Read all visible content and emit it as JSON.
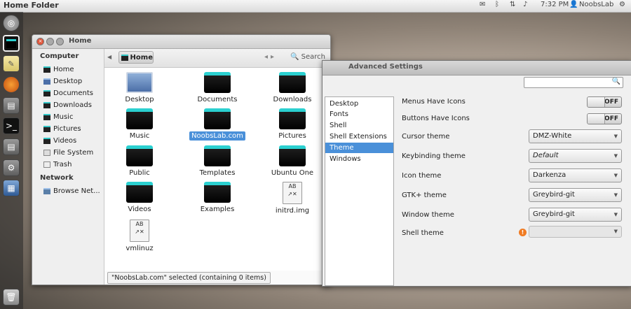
{
  "panel": {
    "title": "Home Folder",
    "clock": "7:32 PM",
    "user": "NoobsLab"
  },
  "launcher": {
    "items": [
      "dash-home",
      "home-folder",
      "text-editor",
      "firefox",
      "system-monitor",
      "terminal",
      "system-monitor-2",
      "system-settings",
      "workspace-switcher",
      "trash"
    ]
  },
  "file_manager": {
    "title": "Home",
    "sidebar": {
      "computer_heading": "Computer",
      "computer_items": [
        "Home",
        "Desktop",
        "Documents",
        "Downloads",
        "Music",
        "Pictures",
        "Videos",
        "File System",
        "Trash"
      ],
      "network_heading": "Network",
      "network_items": [
        "Browse Net..."
      ]
    },
    "breadcrumb": "Home",
    "search_label": "Search",
    "items": [
      {
        "label": "Desktop",
        "kind": "desktop"
      },
      {
        "label": "Documents",
        "kind": "folder"
      },
      {
        "label": "Downloads",
        "kind": "folder"
      },
      {
        "label": "Music",
        "kind": "folder"
      },
      {
        "label": "NoobsLab.com",
        "kind": "folder",
        "selected": true
      },
      {
        "label": "Pictures",
        "kind": "folder"
      },
      {
        "label": "Public",
        "kind": "folder"
      },
      {
        "label": "Templates",
        "kind": "folder"
      },
      {
        "label": "Ubuntu One",
        "kind": "folder"
      },
      {
        "label": "Videos",
        "kind": "folder"
      },
      {
        "label": "Examples",
        "kind": "folder"
      },
      {
        "label": "initrd.img",
        "kind": "file"
      },
      {
        "label": "vmlinuz",
        "kind": "file"
      }
    ],
    "status": "\"NoobsLab.com\" selected (containing 0 items)"
  },
  "advanced_settings": {
    "title": "Advanced Settings",
    "categories": [
      "Desktop",
      "Fonts",
      "Shell",
      "Shell Extensions",
      "Theme",
      "Windows"
    ],
    "selected_category": "Theme",
    "toggles": [
      {
        "label": "Menus Have Icons",
        "state": "OFF"
      },
      {
        "label": "Buttons Have Icons",
        "state": "OFF"
      }
    ],
    "selects": [
      {
        "label": "Cursor theme",
        "value": "DMZ-White"
      },
      {
        "label": "Keybinding theme",
        "value": "Default"
      },
      {
        "label": "Icon theme",
        "value": "Darkenza"
      },
      {
        "label": "GTK+ theme",
        "value": "Greybird-git"
      },
      {
        "label": "Window theme",
        "value": "Greybird-git"
      },
      {
        "label": "Shell theme",
        "value": ""
      }
    ]
  }
}
